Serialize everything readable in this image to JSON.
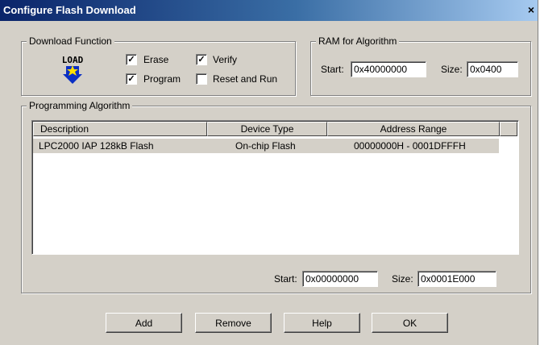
{
  "window": {
    "title": "Configure Flash Download",
    "close_glyph": "×"
  },
  "download_function": {
    "label": "Download Function",
    "icon_text": "LOAD",
    "checkboxes": [
      {
        "label": "Erase",
        "checked": true
      },
      {
        "label": "Verify",
        "checked": true
      },
      {
        "label": "Program",
        "checked": true
      },
      {
        "label": "Reset and Run",
        "checked": false
      }
    ]
  },
  "ram_for_algorithm": {
    "label": "RAM for Algorithm",
    "start_label": "Start:",
    "start_value": "0x40000000",
    "size_label": "Size:",
    "size_value": "0x0400"
  },
  "programming_algorithm": {
    "label": "Programming Algorithm",
    "columns": [
      "Description",
      "Device Type",
      "Address Range"
    ],
    "rows": [
      {
        "description": "LPC2000 IAP 128kB Flash",
        "device_type": "On-chip Flash",
        "address_range": "00000000H - 0001DFFFH"
      }
    ],
    "start_label": "Start:",
    "start_value": "0x00000000",
    "size_label": "Size:",
    "size_value": "0x0001E000"
  },
  "buttons": {
    "add": "Add",
    "remove": "Remove",
    "help": "Help",
    "ok": "OK"
  },
  "colors": {
    "dialog_bg": "#d4d0c8",
    "title_start": "#0a246a",
    "title_end": "#a6caf0",
    "check_mark": "#000000"
  }
}
